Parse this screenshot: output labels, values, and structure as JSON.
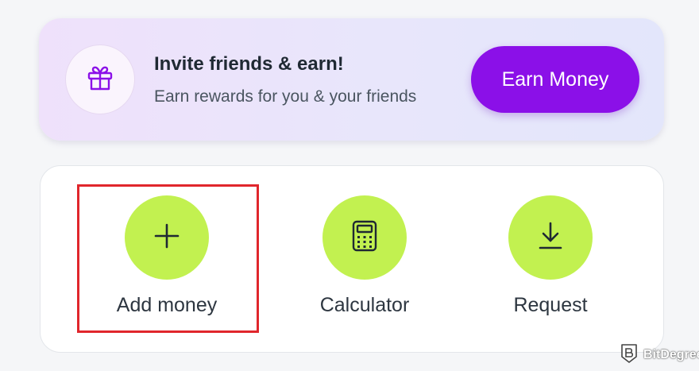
{
  "promo": {
    "icon": "gift-icon",
    "title": "Invite friends & earn!",
    "subtitle": "Earn rewards for you & your friends",
    "button_label": "Earn Money",
    "button_color": "#8b10e8"
  },
  "actions": {
    "items": [
      {
        "label": "Add money",
        "icon": "plus-icon"
      },
      {
        "label": "Calculator",
        "icon": "calculator-icon"
      },
      {
        "label": "Request",
        "icon": "download-icon"
      }
    ],
    "accent_color": "#c2f150",
    "highlight_color": "#e0262c"
  },
  "watermark": {
    "text": "BitDegree"
  }
}
